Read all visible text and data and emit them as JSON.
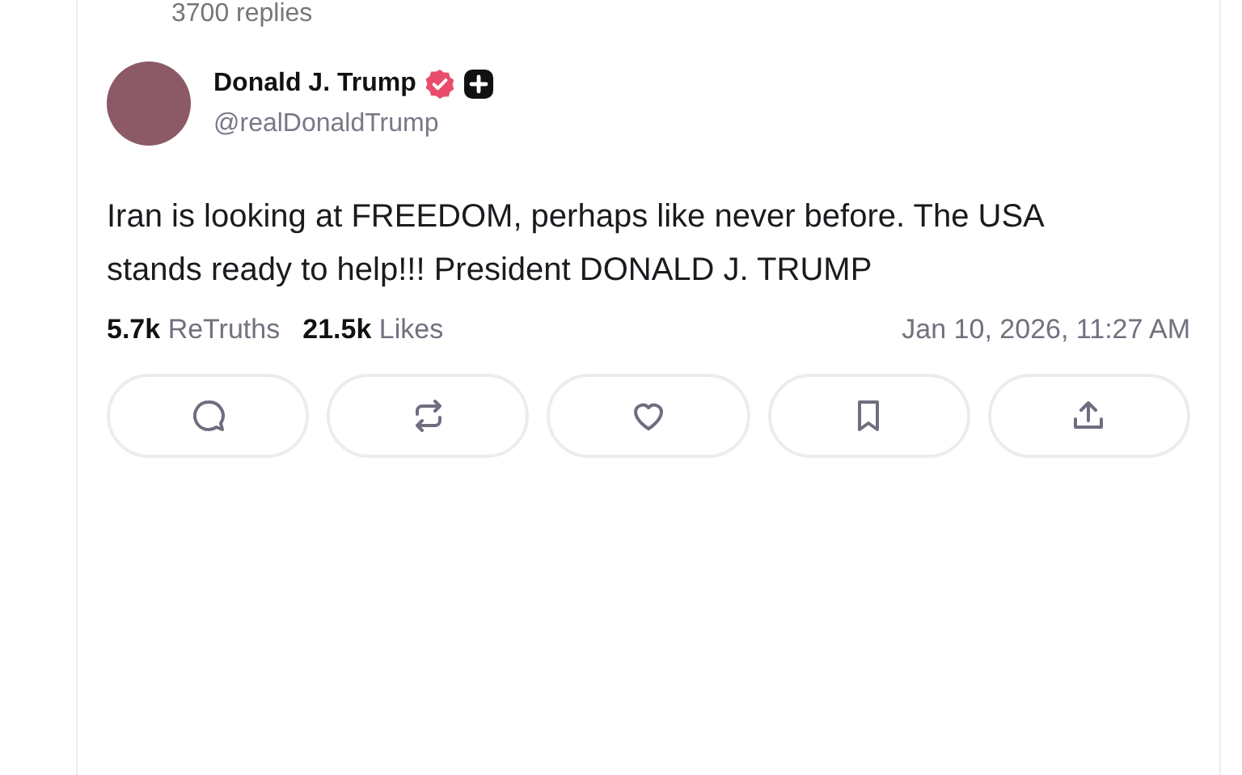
{
  "previous_post": {
    "replies": "3700 replies"
  },
  "post": {
    "author": {
      "name": "Donald J. Trump",
      "verified": true,
      "handle": "@realDonaldTrump"
    },
    "text": "Iran is looking at FREEDOM, perhaps like never before. The USA stands ready to help!!! President DONALD J. TRUMP",
    "stats": [
      {
        "count": "5.7k",
        "label": "ReTruths"
      },
      {
        "count": "21.5k",
        "label": "Likes"
      }
    ],
    "timestamp": "Jan 10, 2026, 11:27 AM",
    "actions": [
      {
        "kind": "reply"
      },
      {
        "kind": "retruth"
      },
      {
        "kind": "like"
      },
      {
        "kind": "bookmark"
      },
      {
        "kind": "share"
      }
    ]
  }
}
